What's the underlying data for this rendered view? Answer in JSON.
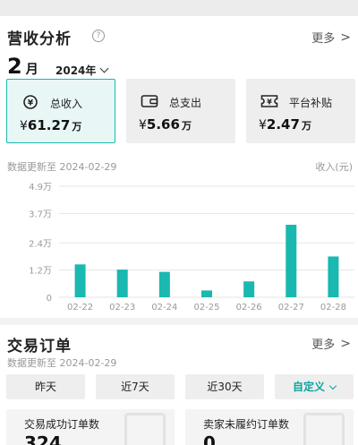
{
  "revenue": {
    "title": "营收分析",
    "help": "?",
    "more": "更多",
    "month": "2",
    "month_unit": "月",
    "year": "2024年",
    "stats": [
      {
        "label": "总收入",
        "currency": "¥",
        "amount": "61.27",
        "unit": "万",
        "icon": "yen-coin-icon"
      },
      {
        "label": "总支出",
        "currency": "¥",
        "amount": "5.66",
        "unit": "万",
        "icon": "wallet-icon"
      },
      {
        "label": "平台补贴",
        "currency": "¥",
        "amount": "2.47",
        "unit": "万",
        "icon": "ticket-icon"
      }
    ],
    "updated": "数据更新至 2024-02-29",
    "y_unit": "收入(元)"
  },
  "chart_data": {
    "type": "bar",
    "categories": [
      "02-22",
      "02-23",
      "02-24",
      "02-25",
      "02-26",
      "02-27",
      "02-28"
    ],
    "values": [
      1.45,
      1.22,
      1.12,
      0.3,
      0.7,
      3.2,
      1.8
    ],
    "ytick_labels": [
      "0",
      "1.2万",
      "2.4万",
      "3.7万",
      "4.9万"
    ],
    "ytick_values": [
      0,
      1.2,
      2.4,
      3.7,
      4.9
    ],
    "ylim": [
      0,
      4.9
    ],
    "color": "#19b8b0",
    "grid": true,
    "title": "",
    "xlabel": "",
    "ylabel": "收入(元)"
  },
  "orders": {
    "title": "交易订单",
    "more": "更多",
    "updated": "数据更新至 2024-02-29",
    "ranges": [
      "昨天",
      "近7天",
      "近30天",
      "自定义"
    ],
    "metrics": [
      {
        "label": "交易成功订单数",
        "value": "324"
      },
      {
        "label": "卖家未履约订单数",
        "value": "0"
      }
    ]
  },
  "colors": {
    "accent": "#19b8b0",
    "accent_text": "#0aa59f"
  }
}
